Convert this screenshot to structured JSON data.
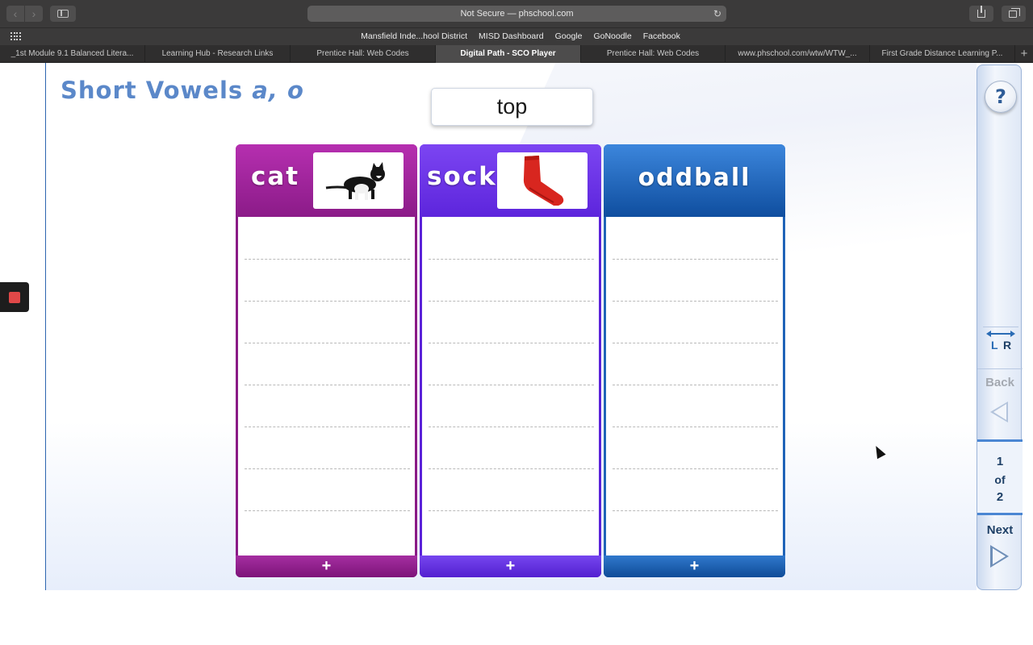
{
  "browser": {
    "address": "Not Secure — phschool.com",
    "nav_back": "‹",
    "nav_forward": "›",
    "reload": "↻",
    "bookmarks": [
      "Mansfield Inde...hool District",
      "MISD Dashboard",
      "Google",
      "GoNoodle",
      "Facebook"
    ],
    "tabs": [
      {
        "label": "_1st Module 9.1 Balanced Litera..."
      },
      {
        "label": "Learning Hub - Research Links"
      },
      {
        "label": "Prentice Hall: Web Codes"
      },
      {
        "label": "Digital Path - SCO Player",
        "active": true
      },
      {
        "label": "Prentice Hall: Web Codes"
      },
      {
        "label": "www.phschool.com/wtw/WTW_..."
      },
      {
        "label": "First Grade Distance Learning P..."
      }
    ],
    "new_tab": "+"
  },
  "activity": {
    "title_main": "Short Vowels",
    "title_vowels": "a, o",
    "current_word": "top",
    "columns": [
      {
        "label": "cat",
        "picture": "cat-photo",
        "color": "#8a1a86",
        "add": "+"
      },
      {
        "label": "sock",
        "picture": "red-sock-photo",
        "color": "#5a22d9",
        "add": "+"
      },
      {
        "label": "oddball",
        "picture": null,
        "color": "#1f63b8",
        "add": "+"
      }
    ]
  },
  "side_panel": {
    "help": "?",
    "direction_left": "L",
    "direction_right": "R",
    "back_label": "Back",
    "page_current": "1",
    "page_of": "of",
    "page_total": "2",
    "next_label": "Next"
  },
  "colors": {
    "title": "#5b88c9",
    "panel_accent": "#4a86d3",
    "stop": "#e04848"
  }
}
